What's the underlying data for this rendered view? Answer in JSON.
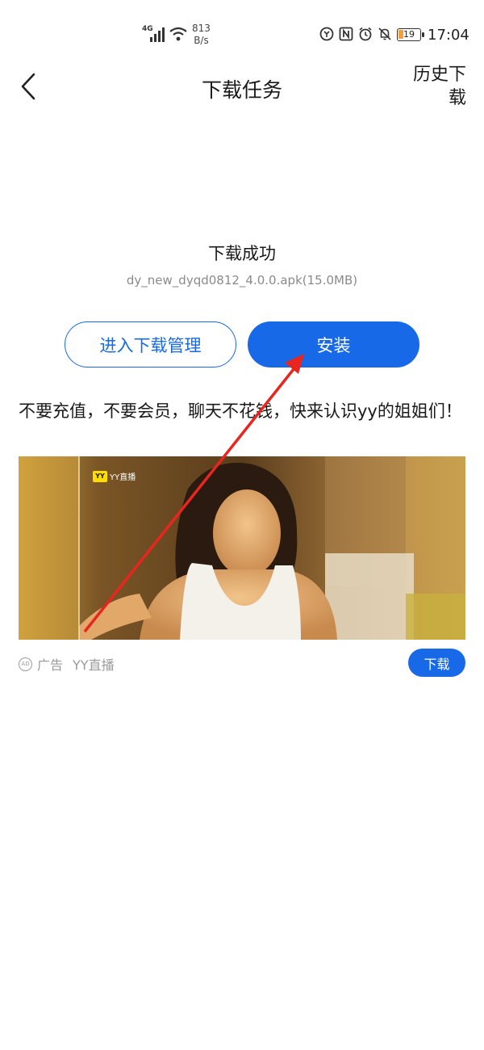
{
  "status_bar": {
    "network": "4G",
    "speed_value": "813",
    "speed_unit": "B/s",
    "battery_level": "19",
    "time": "17:04"
  },
  "header": {
    "title": "下载任务",
    "history_label": "历史下载"
  },
  "download": {
    "status": "下载成功",
    "file_info": "dy_new_dyqd0812_4.0.0.apk(15.0MB)",
    "manage_label": "进入下载管理",
    "install_label": "安装"
  },
  "ad": {
    "headline": "不要充值，不要会员，聊天不花钱，快来认识yy的姐姐们！",
    "image_logo_badge": "YY",
    "image_logo_text": "YY直播",
    "ad_label": "广告",
    "ad_mark": "AD",
    "advertiser": "YY直播",
    "download_label": "下载"
  },
  "colors": {
    "accent": "#1769e8",
    "annotation": "#e8261f"
  },
  "icons": {
    "back": "back-arrow-icon",
    "nfc": "nfc-icon",
    "alarm": "alarm-icon",
    "mute": "bell-off-icon"
  }
}
